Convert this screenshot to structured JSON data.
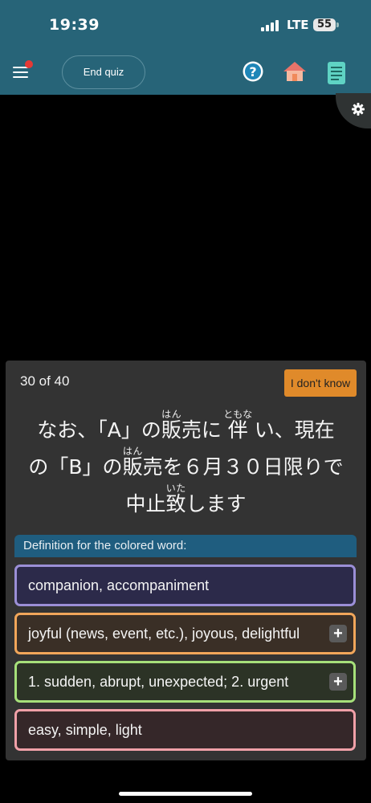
{
  "status_bar": {
    "time": "19:39",
    "network": "LTE",
    "battery": "55"
  },
  "header": {
    "end_quiz_label": "End quiz"
  },
  "quiz": {
    "progress": "30 of 40",
    "idk_label": "I don't know",
    "sentence": {
      "seg1": "なお、「A」の",
      "w1_base": "販",
      "w1_ruby": "はん",
      "w1_tail": "売に ",
      "w2_base": "伴",
      "w2_ruby": "ともな",
      "w2_tail": " い、現在",
      "seg2": "の「B」の",
      "w3_base": "販",
      "w3_ruby": "はん",
      "w3_tail": "売を６月３０日限りで",
      "seg3": "中止",
      "w4_base": "致",
      "w4_ruby": "いた",
      "w4_tail": "します"
    },
    "definition_label": "Definition for the colored word:",
    "choices": [
      {
        "text": "companion, accompaniment",
        "border": "#9b8fd6",
        "bg": "#2c2a4a",
        "has_plus": false
      },
      {
        "text": "joyful (news, event, etc.), joyous, delightful",
        "border": "#f0a65a",
        "bg": "#3a2f26",
        "has_plus": true,
        "plus": "+"
      },
      {
        "text": "1. sudden, abrupt, unexpected; 2. urgent",
        "border": "#a6e07a",
        "bg": "#2c3326",
        "has_plus": true,
        "plus": "+"
      },
      {
        "text": "easy, simple, light",
        "border": "#f0a0a8",
        "bg": "#352729",
        "has_plus": false
      }
    ]
  }
}
